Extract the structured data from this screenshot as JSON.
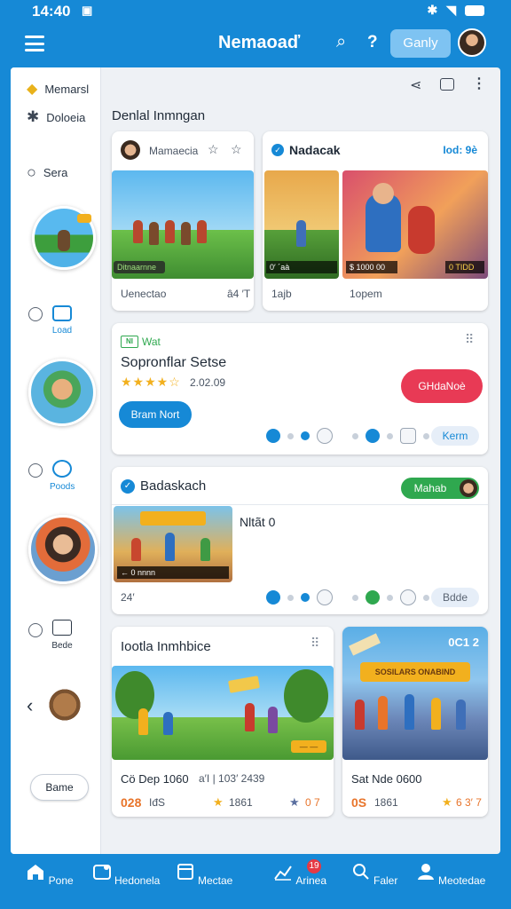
{
  "status": {
    "time": "14:40"
  },
  "appbar": {
    "title": "Nemaoaď",
    "help": "?",
    "gbtn": "Ganly"
  },
  "sidebar": {
    "items": [
      {
        "label": "Memarsl"
      },
      {
        "label": "Doloeia"
      },
      {
        "label": "Sera"
      }
    ],
    "thumb_labels": [
      "Load",
      "Poods",
      "Bede"
    ],
    "bottom_button": "Bame"
  },
  "main": {
    "section_title": "Denlal Inmngan",
    "card1": {
      "left_header": "Mamaecia",
      "left_bar": "Ditnaarnne",
      "left_foot": "Uenectao",
      "left_foot_num": "â4 ′T",
      "right_header": "Nadacak",
      "right_header_link": "Iod: 9è",
      "mid_bar": "0′ ´aà",
      "mid_foot": "1ajb",
      "right_bar_left": "$ 1000 00",
      "right_bar_right": "0 TIDD",
      "right_foot": "1opem"
    },
    "card2": {
      "tag": "NI",
      "tag_text": "Wat",
      "title": "Sopronflar Setse",
      "rating": "2.02.09",
      "primary": "Bram Nort",
      "pink": "GHdaNoè",
      "pill_right": "Kerm"
    },
    "card3": {
      "title": "Badaskach",
      "green_pill": "Mahab",
      "side_title": "Nltãt 0",
      "foot": "24′",
      "pill_right": "Bdde",
      "img_text": "← 0 nnnn"
    },
    "card4": {
      "title": "Iootla Inmhbice",
      "img_btn": "— —",
      "line1": "Cö Dep 1060",
      "line1b": "a′I | 103′ 2439",
      "price": "028",
      "price_b": "IđS",
      "rate1": "1861",
      "rate2": "0 7"
    },
    "card5": {
      "badge": "0C1 2",
      "img_title": "SOSILARS ONABIND",
      "line1": "Sat Nde 0600",
      "price": "0S",
      "price_b": "1861",
      "rate": "6 3′ 7"
    }
  },
  "nav": [
    {
      "label": "Pone",
      "icon": "home-icon"
    },
    {
      "label": "Hedonela",
      "icon": "gamepad-icon"
    },
    {
      "label": "Mectae",
      "icon": "cards-icon"
    },
    {
      "label": "Arinea",
      "icon": "chart-icon",
      "badge": "19"
    },
    {
      "label": "Faler",
      "icon": "search-icon"
    },
    {
      "label": "Meotedae",
      "icon": "profile-icon"
    }
  ]
}
